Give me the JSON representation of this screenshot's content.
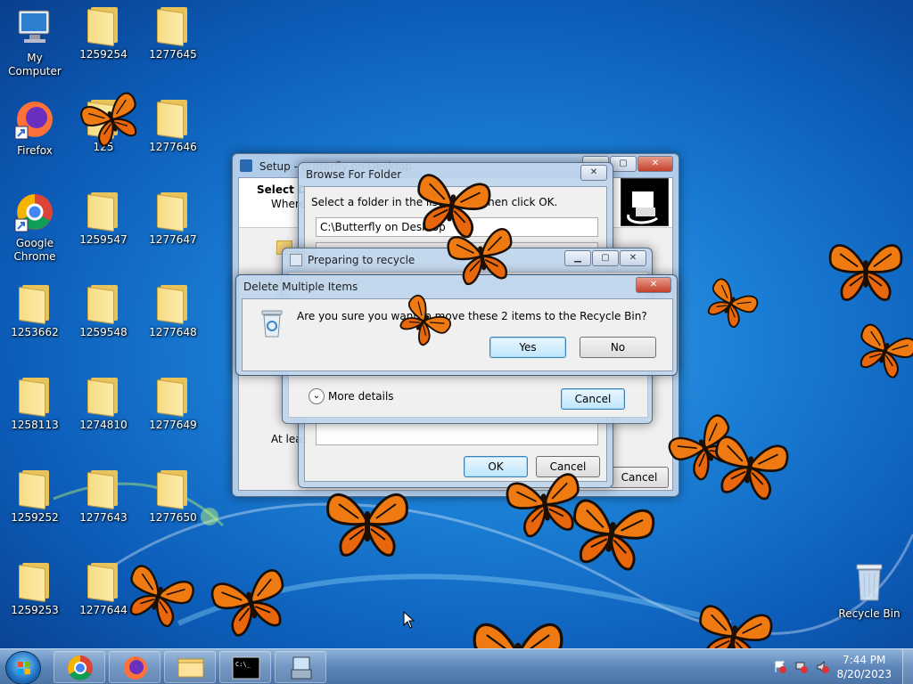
{
  "desktop": {
    "icons": [
      {
        "label": "My Computer",
        "type": "computer"
      },
      {
        "label": "1259254",
        "type": "folder"
      },
      {
        "label": "1277645",
        "type": "folder"
      },
      {
        "label": "Firefox",
        "type": "firefox"
      },
      {
        "label": "125",
        "type": "folder"
      },
      {
        "label": "1277646",
        "type": "folder"
      },
      {
        "label": "Google Chrome",
        "type": "chrome"
      },
      {
        "label": "1259547",
        "type": "folder"
      },
      {
        "label": "1277647",
        "type": "folder"
      },
      {
        "label": "1253662",
        "type": "folder"
      },
      {
        "label": "1259548",
        "type": "folder"
      },
      {
        "label": "1277648",
        "type": "folder"
      },
      {
        "label": "1258113",
        "type": "folder"
      },
      {
        "label": "1274810",
        "type": "folder"
      },
      {
        "label": "1277649",
        "type": "folder"
      },
      {
        "label": "1259252",
        "type": "folder"
      },
      {
        "label": "1277643",
        "type": "folder"
      },
      {
        "label": "1277650",
        "type": "folder"
      },
      {
        "label": "1259253",
        "type": "folder"
      },
      {
        "label": "1277644",
        "type": "folder"
      },
      {
        "label": "Recycle Bin",
        "type": "recycle-bin"
      }
    ]
  },
  "setup_window": {
    "title": "Setup - Butterfly on Desktop",
    "heading": "Select D",
    "subtext": "Where",
    "footer_text": "At leas",
    "cancel_label": "Cancel"
  },
  "browse_dialog": {
    "title": "Browse For Folder",
    "instruction": "Select a folder in the list below, then click OK.",
    "path_value": "C:\\Butterfly on Desktop",
    "ok_label": "OK",
    "cancel_label": "Cancel"
  },
  "preparing_dialog": {
    "title": "Preparing to recycle",
    "more_details_label": "More details",
    "cancel_label": "Cancel"
  },
  "delete_dialog": {
    "title": "Delete Multiple Items",
    "message": "Are you sure you want to move these 2 items to the Recycle Bin?",
    "yes_label": "Yes",
    "no_label": "No"
  },
  "taskbar": {
    "pinned": [
      "chrome",
      "firefox",
      "explorer",
      "cmd",
      "setup"
    ],
    "clock": {
      "time": "7:44 PM",
      "date": "8/20/2023"
    }
  }
}
